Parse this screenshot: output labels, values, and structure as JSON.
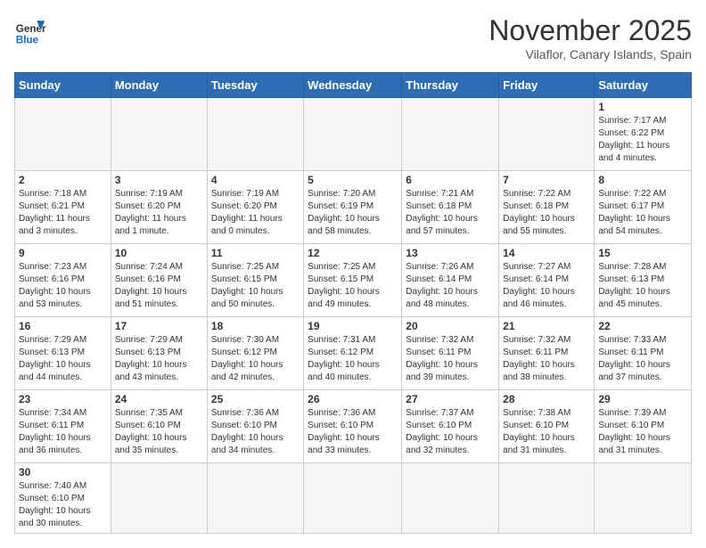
{
  "header": {
    "logo_general": "General",
    "logo_blue": "Blue",
    "month_title": "November 2025",
    "location": "Vilaflor, Canary Islands, Spain"
  },
  "weekdays": [
    "Sunday",
    "Monday",
    "Tuesday",
    "Wednesday",
    "Thursday",
    "Friday",
    "Saturday"
  ],
  "weeks": [
    [
      {
        "day": "",
        "info": ""
      },
      {
        "day": "",
        "info": ""
      },
      {
        "day": "",
        "info": ""
      },
      {
        "day": "",
        "info": ""
      },
      {
        "day": "",
        "info": ""
      },
      {
        "day": "",
        "info": ""
      },
      {
        "day": "1",
        "info": "Sunrise: 7:17 AM\nSunset: 6:22 PM\nDaylight: 11 hours\nand 4 minutes."
      }
    ],
    [
      {
        "day": "2",
        "info": "Sunrise: 7:18 AM\nSunset: 6:21 PM\nDaylight: 11 hours\nand 3 minutes."
      },
      {
        "day": "3",
        "info": "Sunrise: 7:19 AM\nSunset: 6:20 PM\nDaylight: 11 hours\nand 1 minute."
      },
      {
        "day": "4",
        "info": "Sunrise: 7:19 AM\nSunset: 6:20 PM\nDaylight: 11 hours\nand 0 minutes."
      },
      {
        "day": "5",
        "info": "Sunrise: 7:20 AM\nSunset: 6:19 PM\nDaylight: 10 hours\nand 58 minutes."
      },
      {
        "day": "6",
        "info": "Sunrise: 7:21 AM\nSunset: 6:18 PM\nDaylight: 10 hours\nand 57 minutes."
      },
      {
        "day": "7",
        "info": "Sunrise: 7:22 AM\nSunset: 6:18 PM\nDaylight: 10 hours\nand 55 minutes."
      },
      {
        "day": "8",
        "info": "Sunrise: 7:22 AM\nSunset: 6:17 PM\nDaylight: 10 hours\nand 54 minutes."
      }
    ],
    [
      {
        "day": "9",
        "info": "Sunrise: 7:23 AM\nSunset: 6:16 PM\nDaylight: 10 hours\nand 53 minutes."
      },
      {
        "day": "10",
        "info": "Sunrise: 7:24 AM\nSunset: 6:16 PM\nDaylight: 10 hours\nand 51 minutes."
      },
      {
        "day": "11",
        "info": "Sunrise: 7:25 AM\nSunset: 6:15 PM\nDaylight: 10 hours\nand 50 minutes."
      },
      {
        "day": "12",
        "info": "Sunrise: 7:25 AM\nSunset: 6:15 PM\nDaylight: 10 hours\nand 49 minutes."
      },
      {
        "day": "13",
        "info": "Sunrise: 7:26 AM\nSunset: 6:14 PM\nDaylight: 10 hours\nand 48 minutes."
      },
      {
        "day": "14",
        "info": "Sunrise: 7:27 AM\nSunset: 6:14 PM\nDaylight: 10 hours\nand 46 minutes."
      },
      {
        "day": "15",
        "info": "Sunrise: 7:28 AM\nSunset: 6:13 PM\nDaylight: 10 hours\nand 45 minutes."
      }
    ],
    [
      {
        "day": "16",
        "info": "Sunrise: 7:29 AM\nSunset: 6:13 PM\nDaylight: 10 hours\nand 44 minutes."
      },
      {
        "day": "17",
        "info": "Sunrise: 7:29 AM\nSunset: 6:13 PM\nDaylight: 10 hours\nand 43 minutes."
      },
      {
        "day": "18",
        "info": "Sunrise: 7:30 AM\nSunset: 6:12 PM\nDaylight: 10 hours\nand 42 minutes."
      },
      {
        "day": "19",
        "info": "Sunrise: 7:31 AM\nSunset: 6:12 PM\nDaylight: 10 hours\nand 40 minutes."
      },
      {
        "day": "20",
        "info": "Sunrise: 7:32 AM\nSunset: 6:11 PM\nDaylight: 10 hours\nand 39 minutes."
      },
      {
        "day": "21",
        "info": "Sunrise: 7:32 AM\nSunset: 6:11 PM\nDaylight: 10 hours\nand 38 minutes."
      },
      {
        "day": "22",
        "info": "Sunrise: 7:33 AM\nSunset: 6:11 PM\nDaylight: 10 hours\nand 37 minutes."
      }
    ],
    [
      {
        "day": "23",
        "info": "Sunrise: 7:34 AM\nSunset: 6:11 PM\nDaylight: 10 hours\nand 36 minutes."
      },
      {
        "day": "24",
        "info": "Sunrise: 7:35 AM\nSunset: 6:10 PM\nDaylight: 10 hours\nand 35 minutes."
      },
      {
        "day": "25",
        "info": "Sunrise: 7:36 AM\nSunset: 6:10 PM\nDaylight: 10 hours\nand 34 minutes."
      },
      {
        "day": "26",
        "info": "Sunrise: 7:36 AM\nSunset: 6:10 PM\nDaylight: 10 hours\nand 33 minutes."
      },
      {
        "day": "27",
        "info": "Sunrise: 7:37 AM\nSunset: 6:10 PM\nDaylight: 10 hours\nand 32 minutes."
      },
      {
        "day": "28",
        "info": "Sunrise: 7:38 AM\nSunset: 6:10 PM\nDaylight: 10 hours\nand 31 minutes."
      },
      {
        "day": "29",
        "info": "Sunrise: 7:39 AM\nSunset: 6:10 PM\nDaylight: 10 hours\nand 31 minutes."
      }
    ],
    [
      {
        "day": "30",
        "info": "Sunrise: 7:40 AM\nSunset: 6:10 PM\nDaylight: 10 hours\nand 30 minutes."
      },
      {
        "day": "",
        "info": ""
      },
      {
        "day": "",
        "info": ""
      },
      {
        "day": "",
        "info": ""
      },
      {
        "day": "",
        "info": ""
      },
      {
        "day": "",
        "info": ""
      },
      {
        "day": "",
        "info": ""
      }
    ]
  ]
}
